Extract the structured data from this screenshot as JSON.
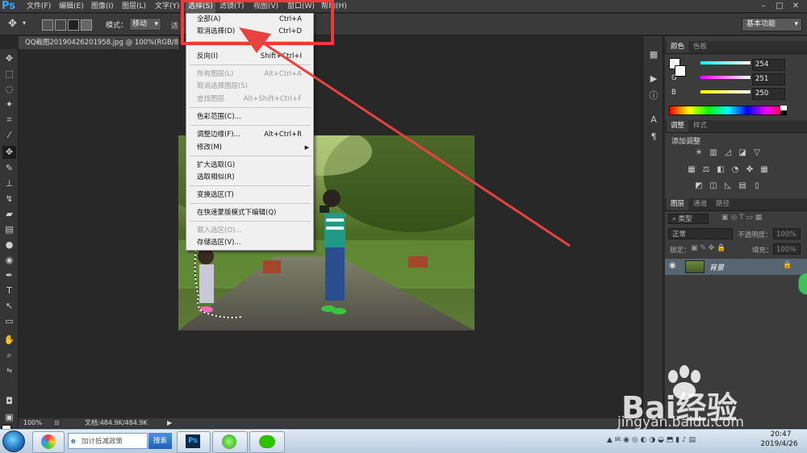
{
  "app": {
    "logo": "Ps"
  },
  "menubar": {
    "items": [
      "文件(F)",
      "编辑(E)",
      "图像(I)",
      "图层(L)",
      "文字(Y)",
      "选择(S)",
      "滤镜(T)",
      "视图(V)",
      "窗口(W)",
      "帮助(H)"
    ],
    "active_index": 5
  },
  "options_bar": {
    "mode_label": "模式：",
    "mode_value": "移动",
    "tail_text": "适",
    "workspace": "基本功能"
  },
  "document": {
    "tab_title": "QQ截图20190426201958.jpg @ 100%(RGB/8#)",
    "tab_close": "×"
  },
  "status_bar": {
    "zoom": "100%",
    "doc_size": "文档:484.9K/484.9K"
  },
  "select_menu": {
    "items": [
      {
        "label": "全部(A)",
        "shortcut": "Ctrl+A",
        "disabled": false
      },
      {
        "label": "取消选择(D)",
        "shortcut": "Ctrl+D",
        "disabled": false
      },
      {
        "label": "反向(I)",
        "shortcut": "Shift+Ctrl+I",
        "disabled": false
      },
      {
        "label": "所有图层(L)",
        "shortcut": "Alt+Ctrl+A",
        "disabled": true
      },
      {
        "label": "取消选择图层(S)",
        "shortcut": "",
        "disabled": true
      },
      {
        "label": "查找图层",
        "shortcut": "Alt+Shift+Ctrl+F",
        "disabled": true
      },
      {
        "label": "色彩范围(C)...",
        "shortcut": "",
        "disabled": false
      },
      {
        "label": "调整边缘(F)...",
        "shortcut": "Alt+Ctrl+R",
        "disabled": false
      },
      {
        "label": "修改(M)",
        "shortcut": "",
        "submenu": true,
        "disabled": false
      },
      {
        "label": "扩大选取(G)",
        "shortcut": "",
        "disabled": false
      },
      {
        "label": "选取相似(R)",
        "shortcut": "",
        "disabled": false
      },
      {
        "label": "变换选区(T)",
        "shortcut": "",
        "disabled": false
      },
      {
        "label": "在快速蒙版模式下编辑(Q)",
        "shortcut": "",
        "disabled": false
      },
      {
        "label": "载入选区(O)...",
        "shortcut": "",
        "disabled": true
      },
      {
        "label": "存储选区(V)...",
        "shortcut": "",
        "disabled": false
      }
    ]
  },
  "color_panel": {
    "tabs": [
      "颜色",
      "色板"
    ],
    "channels": [
      {
        "label": "R",
        "value": "254"
      },
      {
        "label": "G",
        "value": "251"
      },
      {
        "label": "B",
        "value": "250"
      }
    ]
  },
  "adjust_panel": {
    "tabs": [
      "调整",
      "样式"
    ],
    "title": "添加调整"
  },
  "layers_panel": {
    "tabs": [
      "图层",
      "通道",
      "路径"
    ],
    "filter_label": "类型",
    "blend_mode": "正常",
    "opacity_label": "不透明度：",
    "opacity_value": "100%",
    "lock_label": "锁定：",
    "fill_label": "填充：",
    "fill_value": "100%",
    "layer_name": "背景"
  },
  "taskbar": {
    "search_placeholder": "加计抵减政策",
    "search_button": "搜索",
    "time": "20:47",
    "date": "2019/4/26"
  },
  "watermark": {
    "brand": "Bai经验",
    "url": "jingyan.baidu.com"
  },
  "colors": {
    "highlight_box": "#f03a3a",
    "arrow": "#e8423e",
    "menu_bg": "#f0f0f0",
    "panel_bg": "#3c3c3c"
  }
}
